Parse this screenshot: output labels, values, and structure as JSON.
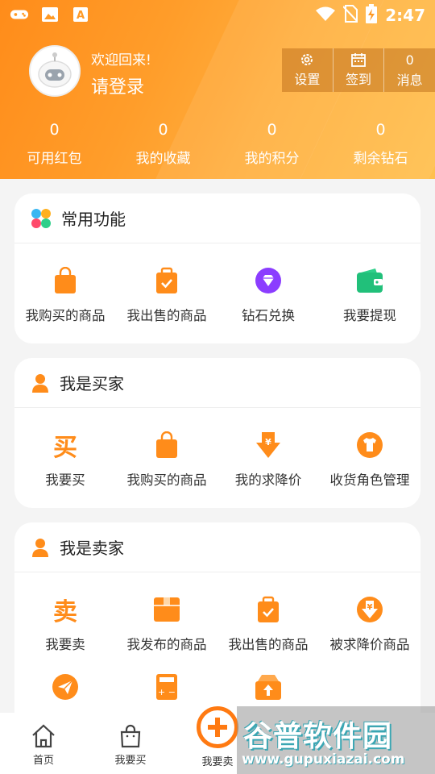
{
  "status": {
    "time": "2:47"
  },
  "profile": {
    "welcome": "欢迎回来!",
    "login": "请登录"
  },
  "top_actions": [
    {
      "label": "设置",
      "icon": "gear-icon"
    },
    {
      "label": "签到",
      "icon": "calendar-icon"
    },
    {
      "value": "0",
      "label": "消息"
    }
  ],
  "stats": [
    {
      "value": "0",
      "label": "可用红包"
    },
    {
      "value": "0",
      "label": "我的收藏"
    },
    {
      "value": "0",
      "label": "我的积分"
    },
    {
      "value": "0",
      "label": "剩余钻石"
    }
  ],
  "common": {
    "title": "常用功能",
    "items": [
      {
        "label": "我购买的商品",
        "icon": "shopping-bag-icon"
      },
      {
        "label": "我出售的商品",
        "icon": "checked-bag-icon"
      },
      {
        "label": "钻石兑换",
        "icon": "diamond-icon"
      },
      {
        "label": "我要提现",
        "icon": "wallet-icon"
      }
    ]
  },
  "buyer": {
    "title": "我是买家",
    "items": [
      {
        "label": "我要买",
        "icon": "buy-char-icon",
        "glyph": "买"
      },
      {
        "label": "我购买的商品",
        "icon": "shopping-bag-icon"
      },
      {
        "label": "我的求降价",
        "icon": "price-down-icon"
      },
      {
        "label": "收货角色管理",
        "icon": "tshirt-icon"
      }
    ]
  },
  "seller": {
    "title": "我是卖家",
    "items": [
      {
        "label": "我要卖",
        "icon": "sell-char-icon",
        "glyph": "卖"
      },
      {
        "label": "我发布的商品",
        "icon": "box-icon"
      },
      {
        "label": "我出售的商品",
        "icon": "checked-bag-icon"
      },
      {
        "label": "被求降价商品",
        "icon": "price-down-circle-icon"
      },
      {
        "label": "",
        "icon": "paper-plane-icon"
      },
      {
        "label": "",
        "icon": "calculator-icon"
      },
      {
        "label": "",
        "icon": "upload-box-icon"
      }
    ]
  },
  "tabs": [
    {
      "label": "首页",
      "icon": "home-icon"
    },
    {
      "label": "我要买",
      "icon": "bag-icon"
    },
    {
      "label": "我要卖",
      "icon": "plus-circle-icon"
    }
  ],
  "watermark": {
    "main": "谷普软件园",
    "url": "www.gupuxiazai.com"
  },
  "colors": {
    "accent": "#ff8c1a",
    "purple": "#8b3dff",
    "green": "#21c07a"
  }
}
